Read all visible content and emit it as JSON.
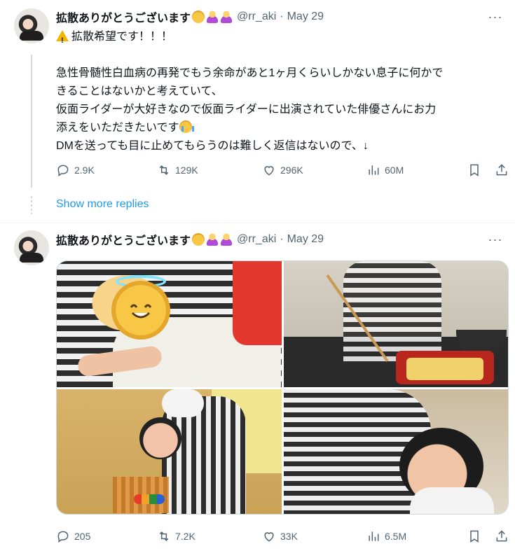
{
  "tweets": [
    {
      "author": {
        "name": "拡散ありがとうございます",
        "handle": "@rr_aki",
        "date": "May 29"
      },
      "more_label": "···",
      "text": {
        "line1": "拡散希望です！！！",
        "line2": "急性骨髄性白血病の再発でもう余命があと1ヶ月くらいしかない息子に何かで",
        "line3": "きることはないかと考えていて、",
        "line4": "仮面ライダーが大好きなので仮面ライダーに出演されていた俳優さんにお力",
        "line5": "添えをいただきたいです",
        "line6": "DMを送っても目に止めてもらうのは難しく返信はないので、↓"
      },
      "stats": {
        "replies": "2.9K",
        "reposts": "129K",
        "likes": "296K",
        "views": "60M"
      }
    },
    {
      "author": {
        "name": "拡散ありがとうございます",
        "handle": "@rr_aki",
        "date": "May 29"
      },
      "more_label": "···",
      "stats": {
        "replies": "205",
        "reposts": "7.2K",
        "likes": "33K",
        "views": "6.5M"
      }
    }
  ],
  "show_more_replies": "Show more replies",
  "separator_dot": "·",
  "icons": {
    "reply": "reply-icon",
    "repost": "repost-icon",
    "like": "heart-icon",
    "views": "views-icon",
    "bookmark": "bookmark-icon",
    "share": "share-icon",
    "warning": "warning-icon"
  },
  "colors": {
    "link": "#1d9bf0",
    "secondary_text": "#536471",
    "thread_line": "#cfd9de"
  }
}
